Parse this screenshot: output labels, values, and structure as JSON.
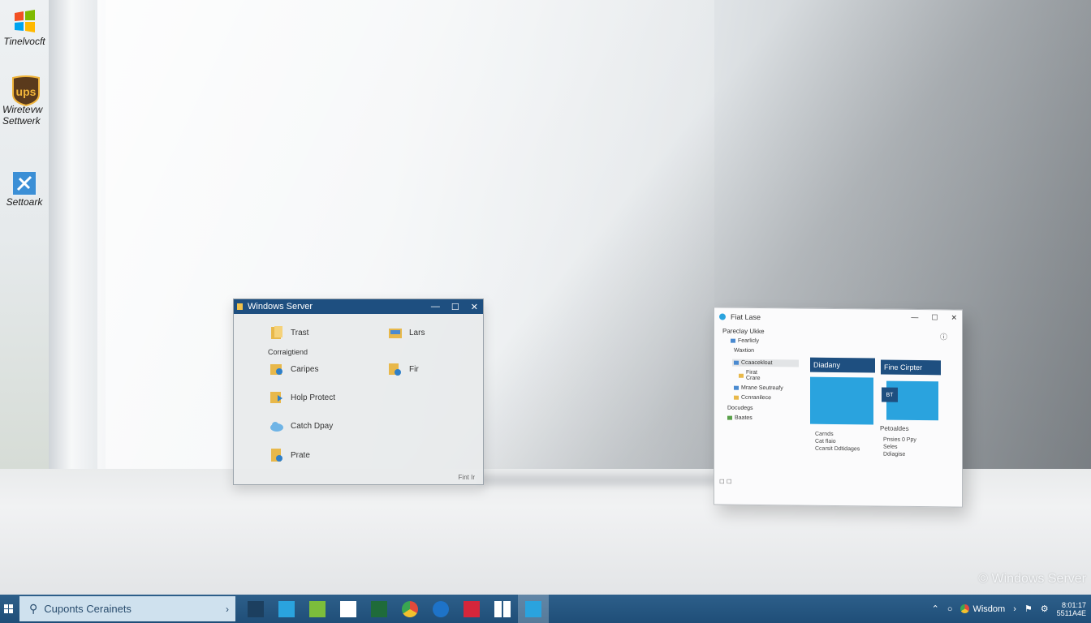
{
  "desktop": {
    "icons": [
      {
        "label": "Tinelvocft",
        "icon": "windows-logo-icon"
      },
      {
        "label": "Wiretevw Settwerk",
        "icon": "ups-logo-icon"
      },
      {
        "label": "Settoark",
        "icon": "network-settings-icon"
      }
    ],
    "watermark": "© Windows Server"
  },
  "left_window": {
    "title": "Windows Server",
    "items": [
      {
        "label": "Trast",
        "icon": "folder-icon"
      },
      {
        "label": "Lars",
        "icon": "folder-icon"
      },
      {
        "label": "Caripes",
        "icon": "folder-settings-icon"
      },
      {
        "label": "Fir",
        "icon": "folder-settings-icon"
      },
      {
        "label": "Holp Protect",
        "icon": "folder-arrow-icon"
      },
      {
        "label": "Catch Dpay",
        "icon": "cloud-icon"
      },
      {
        "label": "Prate",
        "icon": "file-icon"
      }
    ],
    "section_label": "Corraigtiend",
    "status": "Fint   Ir"
  },
  "right_window": {
    "title": "Fiat Lase",
    "tree_header": "Pareclay Ukke",
    "tree": [
      "Fearlicly",
      "Waxtion",
      "Ccaacekloat",
      "Firat Crare",
      "Mrane Seutreafy",
      "Ccnranilece",
      "Docudegs",
      "Baates"
    ],
    "panel_left": {
      "title": "Diadany",
      "list": [
        "Carnds",
        "Cat flaio",
        "Ccarsit Ddtidages"
      ]
    },
    "panel_right": {
      "title": "Fine Cirpter",
      "tile_label": "BT",
      "section": "Petoaldes",
      "list": [
        "Pnsies 0 Ppy",
        "Seles",
        "Ddiagise"
      ]
    }
  },
  "taskbar": {
    "search_placeholder": "Cuponts Cerainets",
    "apps": [
      {
        "icon": "terminal-icon",
        "color": "#1c3f5f"
      },
      {
        "icon": "chat-icon",
        "color": "#2aa3de"
      },
      {
        "icon": "photo-icon",
        "color": "#7cbd3b"
      },
      {
        "icon": "windows-grid-icon",
        "color": "#ffffff"
      },
      {
        "icon": "code-icon",
        "color": "#1f6b3a"
      },
      {
        "icon": "chrome-icon",
        "color": "#e24a3b"
      },
      {
        "icon": "user-icon",
        "color": "#1e73c8"
      },
      {
        "icon": "music-icon",
        "color": "#d6263b"
      },
      {
        "icon": "windows-logo-icon",
        "color": "#ffffff"
      },
      {
        "icon": "store-icon",
        "color": "#2aa3de"
      }
    ],
    "tray_label": "Wisdom",
    "clock_line1": "8:01:17",
    "clock_line2": "5511A4E"
  }
}
